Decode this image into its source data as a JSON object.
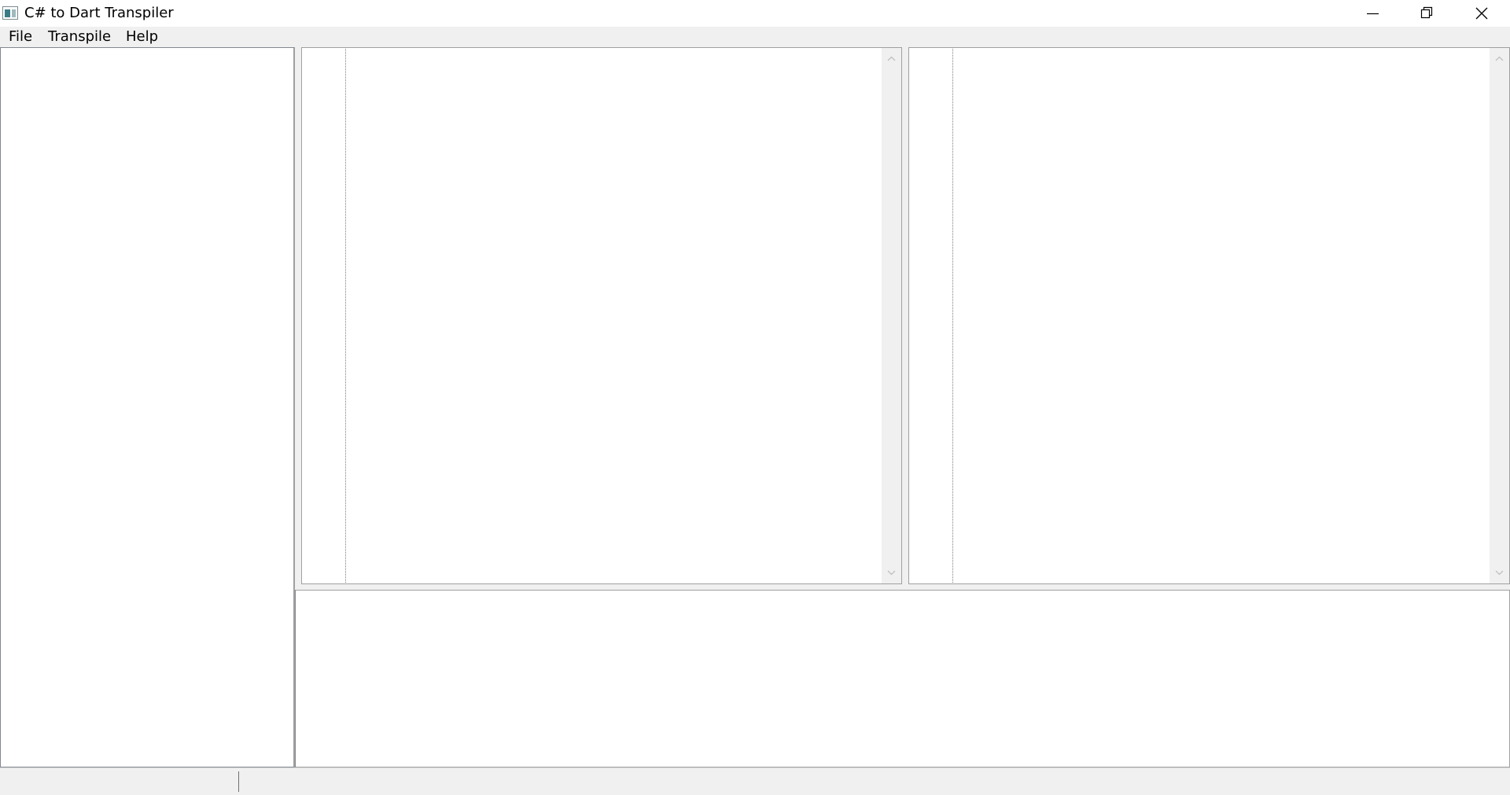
{
  "window": {
    "title": "C# to Dart Transpiler",
    "icons": {
      "app": "app-window-icon",
      "minimize": "minimize-icon",
      "restore": "restore-icon",
      "close": "close-icon"
    }
  },
  "menubar": {
    "items": [
      {
        "label": "File"
      },
      {
        "label": "Transpile"
      },
      {
        "label": "Help"
      }
    ]
  },
  "panes": {
    "tree": {
      "content": ""
    },
    "source_editor": {
      "content": ""
    },
    "output_editor": {
      "content": ""
    },
    "console": {
      "content": ""
    }
  },
  "statusbar": {
    "left_text": "",
    "right_text": ""
  },
  "colors": {
    "titlebar_bg": "#ffffff",
    "chrome_bg": "#f0f0f0",
    "pane_bg": "#ffffff",
    "pane_border": "#a0a0a0",
    "gutter_line": "#7f7f7f"
  }
}
